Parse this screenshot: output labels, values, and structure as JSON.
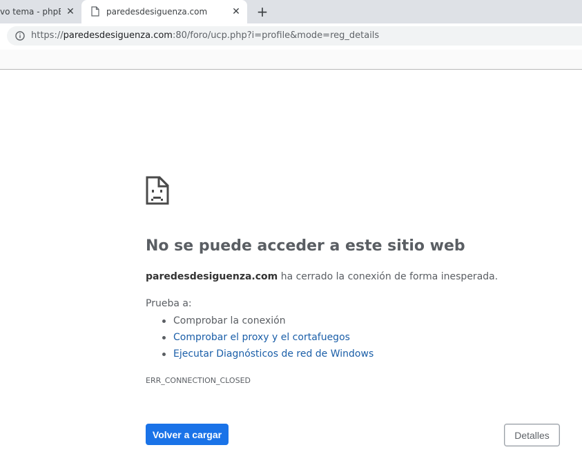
{
  "browser": {
    "tabs": [
      {
        "title": "vo tema - phpBB",
        "active": false
      },
      {
        "title": "paredesdesiguenza.com",
        "active": true
      }
    ],
    "new_tab_symbol": "+",
    "close_symbol": "✕",
    "address": {
      "scheme": "https://",
      "host": "paredesdesiguenza.com",
      "rest": ":80/foro/ucp.php?i=profile&mode=reg_details"
    }
  },
  "error_page": {
    "icon": "sad-page-icon",
    "heading": "No se puede acceder a este sitio web",
    "summary_host": "paredesdesiguenza.com",
    "summary_text": " ha cerrado la conexión de forma inesperada.",
    "try_label": "Prueba a:",
    "suggestions": [
      {
        "text": "Comprobar la conexión",
        "link": false
      },
      {
        "text": "Comprobar el proxy y el cortafuegos",
        "link": true
      },
      {
        "text": "Ejecutar Diagnósticos de red de Windows",
        "link": true
      }
    ],
    "error_code": "ERR_CONNECTION_CLOSED",
    "reload_label": "Volver a cargar",
    "details_label": "Detalles"
  },
  "colors": {
    "primary_button": "#1a73e8",
    "link": "#1a5ea8",
    "text": "#5a5e63"
  }
}
